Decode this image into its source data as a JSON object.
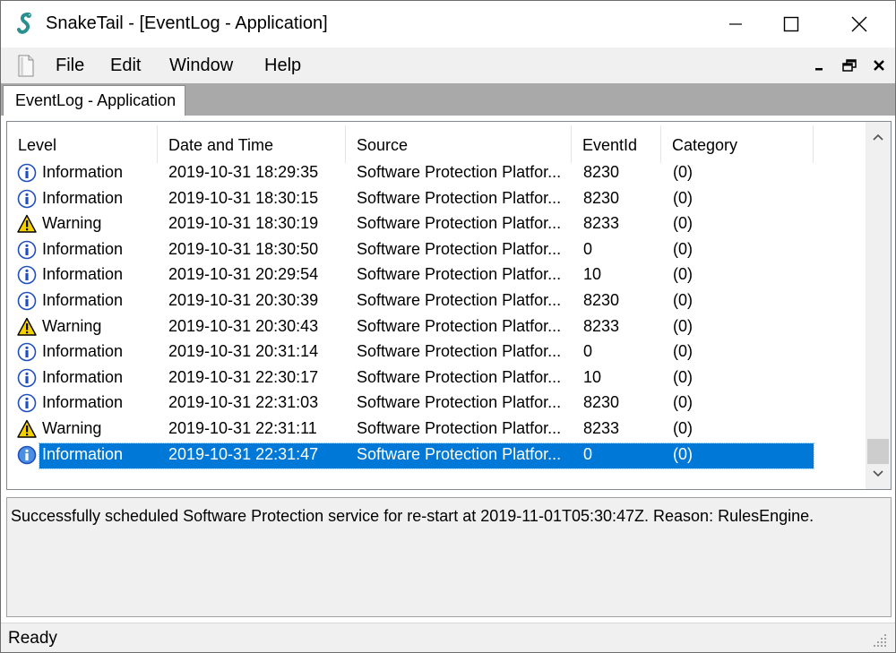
{
  "window": {
    "title": "SnakeTail - [EventLog - Application]",
    "app_icon": "snake-icon"
  },
  "menu": {
    "items": [
      "File",
      "Edit",
      "Window",
      "Help"
    ]
  },
  "tab": {
    "label": "EventLog - Application"
  },
  "table": {
    "columns": [
      "Level",
      "Date and Time",
      "Source",
      "EventId",
      "Category"
    ],
    "rows": [
      {
        "level": "Information",
        "datetime": "2019-10-31 18:29:35",
        "source": "Software Protection Platfor...",
        "eventid": "8230",
        "category": "(0)",
        "icon": "info-icon"
      },
      {
        "level": "Information",
        "datetime": "2019-10-31 18:30:15",
        "source": "Software Protection Platfor...",
        "eventid": "8230",
        "category": "(0)",
        "icon": "info-icon"
      },
      {
        "level": "Warning",
        "datetime": "2019-10-31 18:30:19",
        "source": "Software Protection Platfor...",
        "eventid": "8233",
        "category": "(0)",
        "icon": "warning-icon"
      },
      {
        "level": "Information",
        "datetime": "2019-10-31 18:30:50",
        "source": "Software Protection Platfor...",
        "eventid": "0",
        "category": "(0)",
        "icon": "info-icon"
      },
      {
        "level": "Information",
        "datetime": "2019-10-31 20:29:54",
        "source": "Software Protection Platfor...",
        "eventid": "10",
        "category": "(0)",
        "icon": "info-icon"
      },
      {
        "level": "Information",
        "datetime": "2019-10-31 20:30:39",
        "source": "Software Protection Platfor...",
        "eventid": "8230",
        "category": "(0)",
        "icon": "info-icon"
      },
      {
        "level": "Warning",
        "datetime": "2019-10-31 20:30:43",
        "source": "Software Protection Platfor...",
        "eventid": "8233",
        "category": "(0)",
        "icon": "warning-icon"
      },
      {
        "level": "Information",
        "datetime": "2019-10-31 20:31:14",
        "source": "Software Protection Platfor...",
        "eventid": "0",
        "category": "(0)",
        "icon": "info-icon"
      },
      {
        "level": "Information",
        "datetime": "2019-10-31 22:30:17",
        "source": "Software Protection Platfor...",
        "eventid": "10",
        "category": "(0)",
        "icon": "info-icon"
      },
      {
        "level": "Information",
        "datetime": "2019-10-31 22:31:03",
        "source": "Software Protection Platfor...",
        "eventid": "8230",
        "category": "(0)",
        "icon": "info-icon"
      },
      {
        "level": "Warning",
        "datetime": "2019-10-31 22:31:11",
        "source": "Software Protection Platfor...",
        "eventid": "8233",
        "category": "(0)",
        "icon": "warning-icon"
      },
      {
        "level": "Information",
        "datetime": "2019-10-31 22:31:47",
        "source": "Software Protection Platfor...",
        "eventid": "0",
        "category": "(0)",
        "icon": "info-icon",
        "selected": true
      }
    ]
  },
  "detail": {
    "message": "Successfully scheduled Software Protection service for re-start at 2019-11-01T05:30:47Z. Reason: RulesEngine."
  },
  "status": {
    "text": "Ready"
  },
  "colors": {
    "selection": "#0078d7",
    "tabstrip": "#a9a9a9",
    "chrome": "#f0f0f0"
  }
}
